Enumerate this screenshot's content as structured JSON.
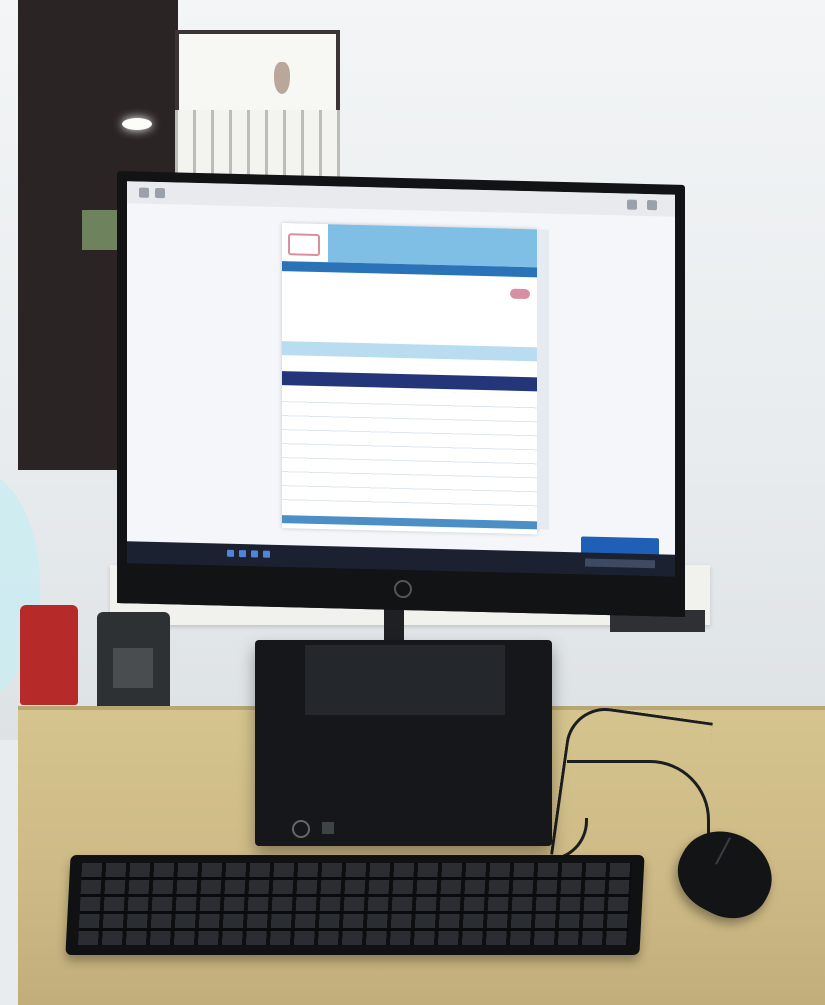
{
  "scene": {
    "kind": "photo",
    "colors": {
      "wall": "#e9ecee",
      "desk": "#d2c08b",
      "monitor_bezel": "#121315",
      "screen_header_blue": "#7fbfe6",
      "screen_table_header": "#24357a",
      "notification": "#1f5fb5",
      "bin_red": "#b72a2a"
    }
  }
}
